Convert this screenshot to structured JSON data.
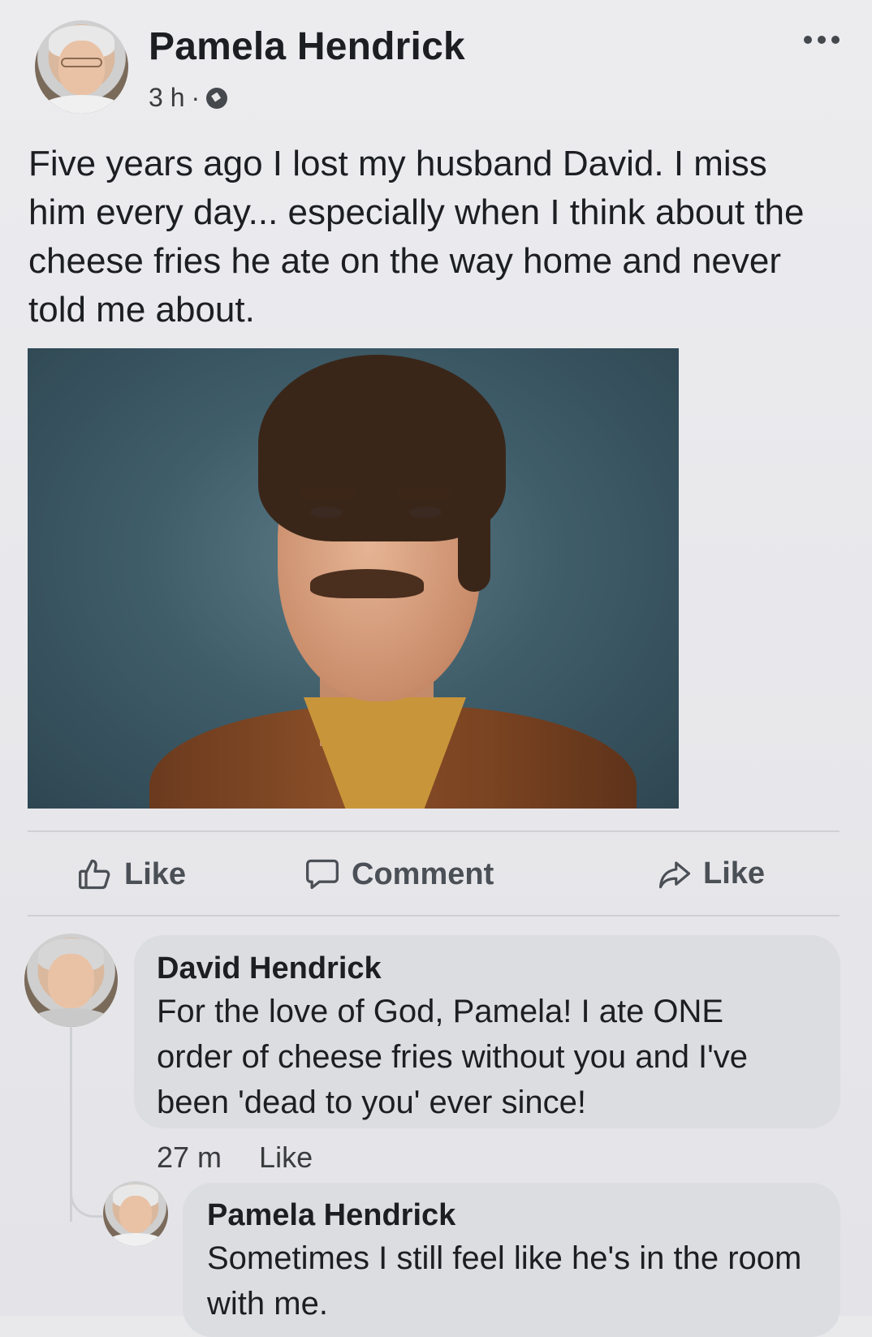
{
  "post": {
    "author": "Pamela Hendrick",
    "time": "3 h",
    "separator": "·",
    "text": "Five years ago I lost my husband David. I miss him every day... especially when I think about the cheese fries he ate on the way home and never told me about."
  },
  "actions": {
    "like_label": "Like",
    "comment_label": "Comment",
    "share_label": "Like"
  },
  "comments": [
    {
      "author": "David Hendrick",
      "text": "For the love of God, Pamela! I ate ONE order of cheese fries without you and I've been 'dead to you' ever since!",
      "time": "27 m",
      "like_label": "Like"
    },
    {
      "author": "Pamela Hendrick",
      "text": "Sometimes I still feel like he's in the room with me."
    }
  ],
  "colors": {
    "background": "#e9e9ec",
    "text": "#1c1e21",
    "bubble": "#dcdde1",
    "icon": "#4b4f56"
  },
  "icons": [
    "globe-icon",
    "more-options-icon",
    "like-icon",
    "comment-icon",
    "share-icon"
  ]
}
